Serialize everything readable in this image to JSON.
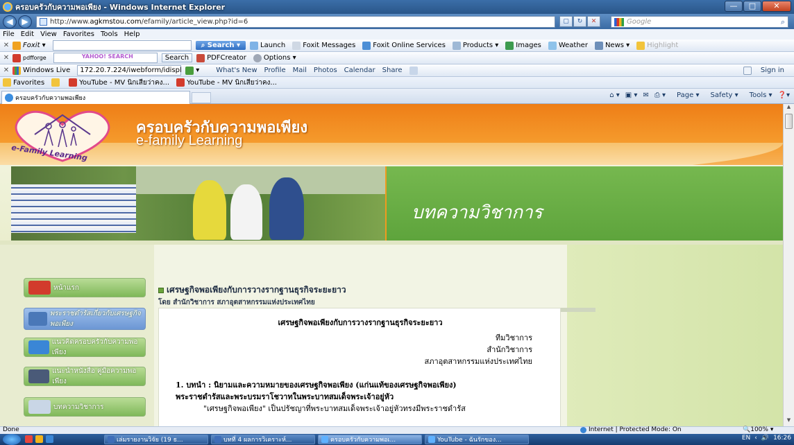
{
  "window": {
    "title": "ครอบครัวกับความพอเพียง - Windows Internet Explorer",
    "min": "—",
    "max": "□",
    "close": "✕"
  },
  "address": {
    "url_prefix": "http://www.",
    "url_domain": "agkmstou.com",
    "url_path": "/efamily/article_view.php?id=6",
    "search_placeholder": "Google"
  },
  "menu": [
    "File",
    "Edit",
    "View",
    "Favorites",
    "Tools",
    "Help"
  ],
  "foxit_toolbar": {
    "brand": "Foxit",
    "search_button": "Search",
    "items": [
      "Launch",
      "Foxit Messages",
      "Foxit Online Services",
      "Products",
      "Images",
      "Weather",
      "News",
      "Highlight"
    ]
  },
  "yahoo_toolbar": {
    "brand": "pdfforge",
    "search_placeholder": "YAHOO! SEARCH",
    "search_button": "Search",
    "pdfcreator": "PDFCreator",
    "options": "Options"
  },
  "live_toolbar": {
    "brand": "Windows Live",
    "input_value": "172.20.7.224/iwebform/idispl",
    "items": [
      "What's New",
      "Profile",
      "Mail",
      "Photos",
      "Calendar",
      "Share"
    ],
    "sign_in": "Sign in"
  },
  "favorites_bar": {
    "label": "Favorites",
    "items": [
      "YouTube - MV นิกเสียว่าคง...",
      "YouTube - MV นิกเสียว่าคง..."
    ]
  },
  "tab": {
    "title": "ครอบครัวกับความพอเพียง"
  },
  "command_bar": [
    "Page",
    "Safety",
    "Tools"
  ],
  "site": {
    "logo_text": "e-Family Learning",
    "title": "ครอบครัวกับความพอเพียง",
    "subtitle": "e-family Learning",
    "banner_title": "บทความวิชาการ"
  },
  "sidebar": [
    {
      "label": "หน้าแรก"
    },
    {
      "label": "พระราชดำรัสเกี่ยวกับเศรษฐกิจพอเพียง"
    },
    {
      "label": "แนวคิดครอบครัวกับความพอเพียง"
    },
    {
      "label": "แนะนำหนังสือ คู่มือความพอเพียง"
    },
    {
      "label": "บทความวิชาการ"
    }
  ],
  "article": {
    "heading": "เศรษฐกิจพอเพียงกับการวางรากฐานธุรกิจระยะยาว",
    "byline": "โดย สำนักวิชาการ สภาอุตสาหกรรมแห่งประเทศไทย",
    "doc_title": "เศรษฐกิจพอเพียงกับการวางรากฐานธุรกิจระยะยาว",
    "author_lines": [
      "ทีมวิชาการ",
      "สำนักวิชาการ",
      "สภาอุตสาหกรรมแห่งประเทศไทย"
    ],
    "section": "1. บทนำ : นิยามและความหมายของเศรษฐกิจพอเพียง (แก่นแท้ของเศรษฐกิจพอเพียง)",
    "section2": "พระราชดำรัสและพระบรมราโชวาทในพระบาทสมเด็จพระเจ้าอยู่หัว",
    "para": "\"เศรษฐกิจพอเพียง\" เป็นปรัชญาที่พระบาทสมเด็จพระเจ้าอยู่หัวทรงมีพระราชดำรัส"
  },
  "status": {
    "left": "Done",
    "zone": "Internet | Protected Mode: On",
    "zoom": "100%"
  },
  "taskbar": {
    "tasks": [
      "เล่มรายงานวิจัย (19 ธ...",
      "บทที่ 4 ผลการวิเคราะห์...",
      "ครอบครัวกับความพอเ...",
      "YouTube - ฉันรักของ..."
    ],
    "lang": "EN",
    "time": "16:26"
  },
  "colors": {
    "header_orange": "#ee7e17",
    "banner_green": "#6aae45",
    "menu_green": "#8fc268"
  }
}
